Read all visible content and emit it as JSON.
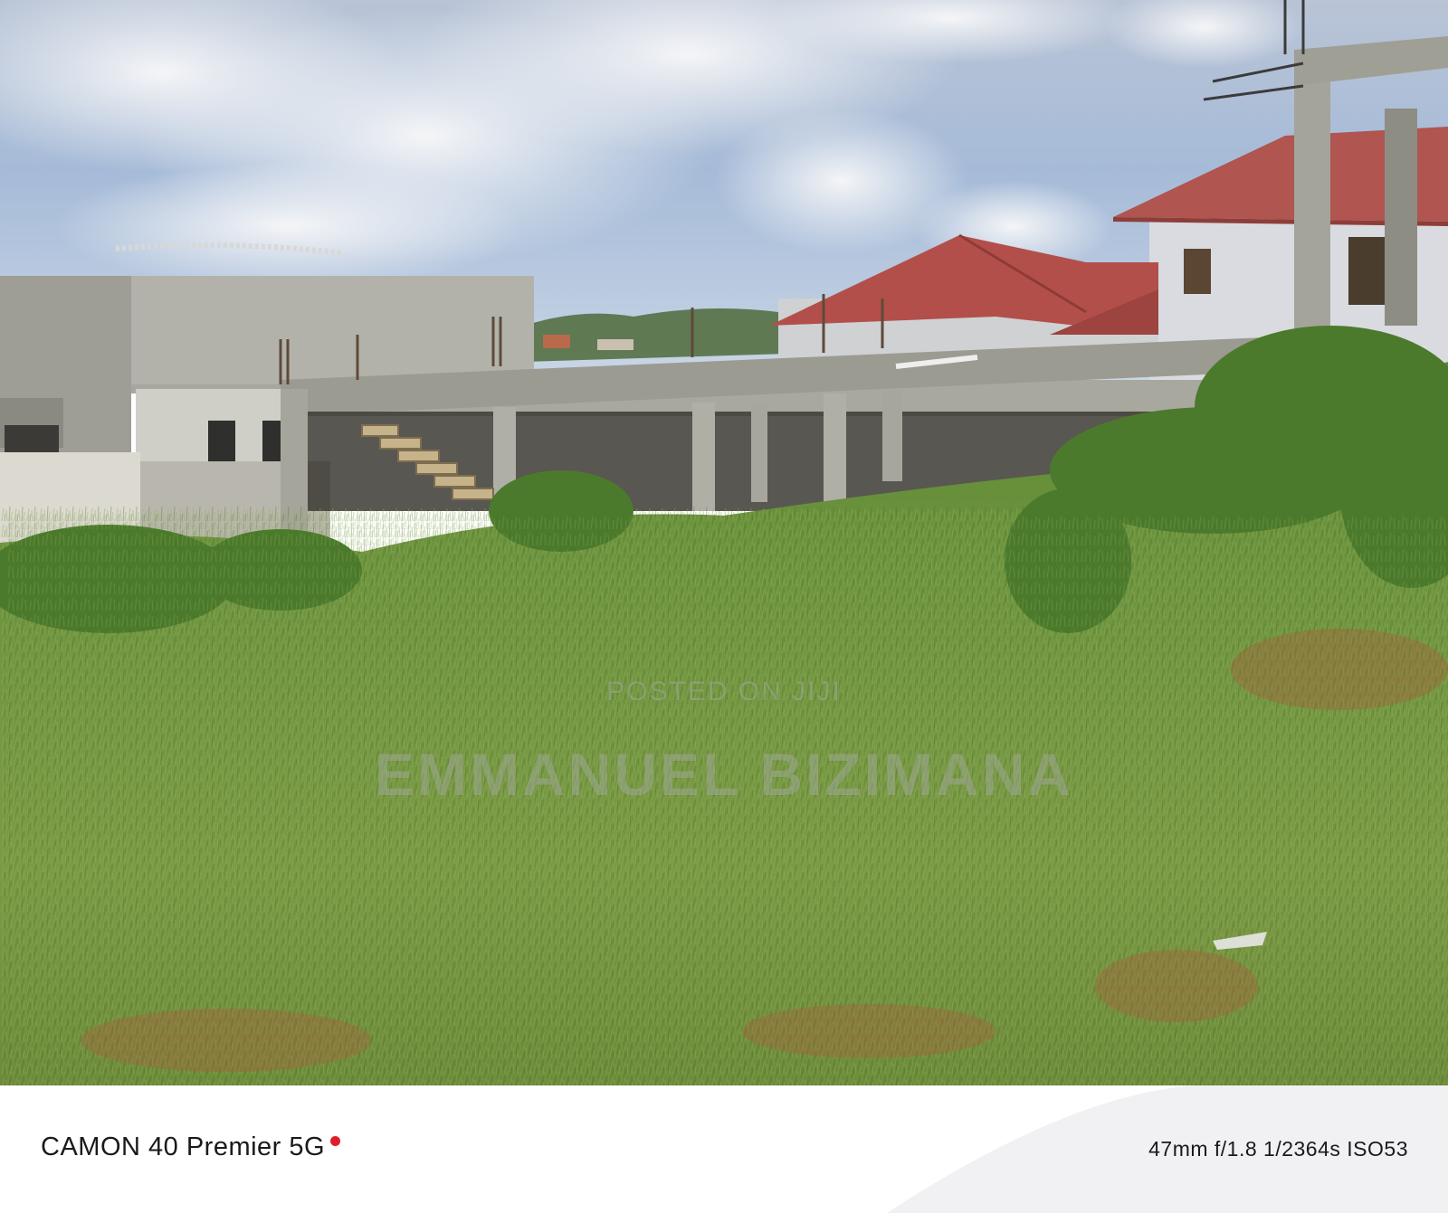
{
  "photo": {
    "scene": "Overgrown plot with unfinished concrete buildings and red-roofed houses under a cloudy sky"
  },
  "watermark": {
    "line1": "POSTED ON JIJI",
    "line2": "EMMANUEL BIZIMANA"
  },
  "camera": {
    "model": "CAMON 40 Premier 5G",
    "dot_color": "#e01e2b",
    "exif": "47mm  f/1.8  1/2364s  ISO53"
  }
}
